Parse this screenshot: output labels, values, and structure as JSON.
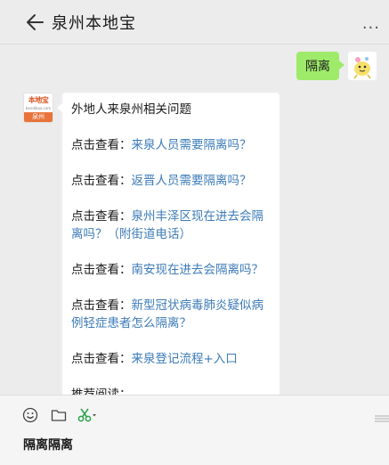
{
  "window": {
    "pin_icon": "pin-icon",
    "min_icon": "minimize-icon",
    "max_icon": "maximize-icon",
    "close_icon": "close-icon"
  },
  "header": {
    "title": "泉州本地宝",
    "back_icon": "back-arrow-icon",
    "more_icon": "more-icon",
    "more_glyph": "..."
  },
  "messages": {
    "sent": {
      "text": "隔离"
    },
    "received": {
      "avatar": {
        "brand": "本地宝",
        "site": "bendibao.com",
        "city": "泉州"
      },
      "intro": "外地人来泉州相关问题",
      "items": [
        {
          "prefix": "点击查看：",
          "link": "来泉人员需要隔离吗？"
        },
        {
          "prefix": "点击查看：",
          "link": "返晋人员需要隔离吗？"
        },
        {
          "prefix": "点击查看：",
          "link": "泉州丰泽区现在进去会隔离吗？（附街道电话）"
        },
        {
          "prefix": "点击查看：",
          "link": "南安现在进去会隔离吗？"
        },
        {
          "prefix": "点击查看：",
          "link": "新型冠状病毒肺炎疑似病例轻症患者怎么隔离？"
        },
        {
          "prefix": "点击查看：",
          "link": "来泉登记流程+入口"
        }
      ],
      "trailing": "推荐阅读："
    }
  },
  "input": {
    "text": "隔离隔离",
    "tools": [
      "emoji-icon",
      "folder-icon",
      "scissors-icon"
    ]
  }
}
